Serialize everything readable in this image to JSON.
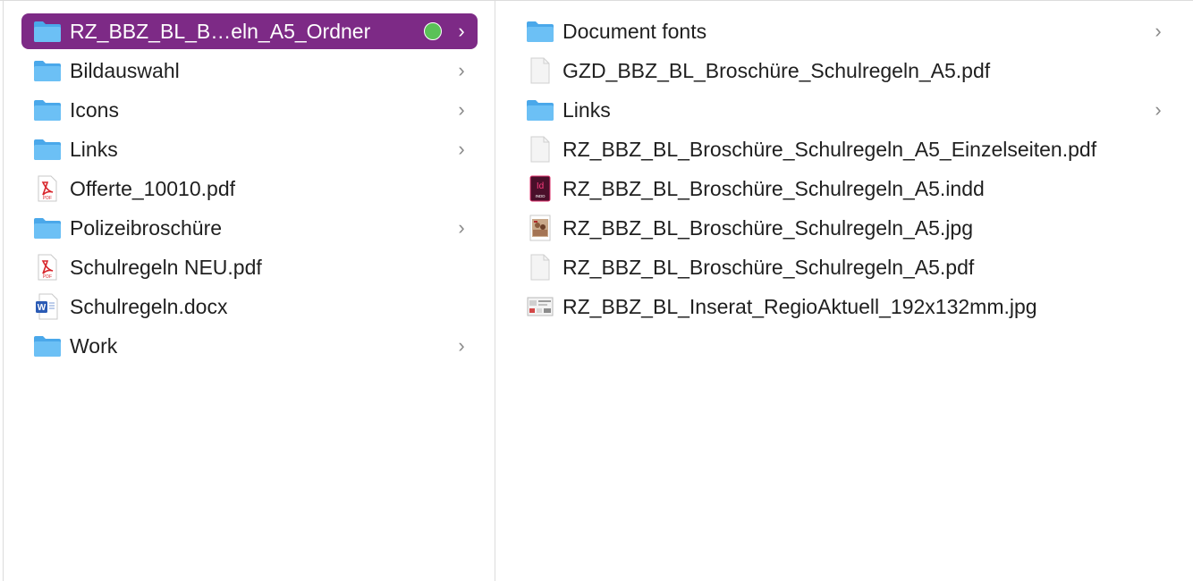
{
  "column1": {
    "items": [
      {
        "label": "RZ_BBZ_BL_B…eln_A5_Ordner",
        "icon": "folder-icon",
        "chevron": "›",
        "selected": true,
        "tag_color": "#5ac157"
      },
      {
        "label": "Bildauswahl",
        "icon": "folder-icon",
        "chevron": "›"
      },
      {
        "label": "Icons",
        "icon": "folder-icon",
        "chevron": "›"
      },
      {
        "label": "Links",
        "icon": "folder-icon",
        "chevron": "›"
      },
      {
        "label": "Offerte_10010.pdf",
        "icon": "pdf-file-icon",
        "chevron": ""
      },
      {
        "label": "Polizeibroschüre",
        "icon": "folder-icon",
        "chevron": "›"
      },
      {
        "label": "Schulregeln NEU.pdf",
        "icon": "pdf-file-icon",
        "chevron": ""
      },
      {
        "label": "Schulregeln.docx",
        "icon": "word-file-icon",
        "chevron": ""
      },
      {
        "label": "Work",
        "icon": "folder-icon",
        "chevron": "›"
      }
    ]
  },
  "column2": {
    "items": [
      {
        "label": "Document fonts",
        "icon": "folder-icon",
        "chevron": "›"
      },
      {
        "label": "GZD_BBZ_BL_Broschüre_Schulregeln_A5.pdf",
        "icon": "blank-file-icon",
        "chevron": ""
      },
      {
        "label": "Links",
        "icon": "folder-icon",
        "chevron": "›"
      },
      {
        "label": "RZ_BBZ_BL_Broschüre_Schulregeln_A5_Einzelseiten.pdf",
        "icon": "blank-file-icon",
        "chevron": ""
      },
      {
        "label": "RZ_BBZ_BL_Broschüre_Schulregeln_A5.indd",
        "icon": "indesign-file-icon",
        "chevron": ""
      },
      {
        "label": "RZ_BBZ_BL_Broschüre_Schulregeln_A5.jpg",
        "icon": "image-thumbnail-icon",
        "chevron": ""
      },
      {
        "label": "RZ_BBZ_BL_Broschüre_Schulregeln_A5.pdf",
        "icon": "blank-file-icon",
        "chevron": ""
      },
      {
        "label": "RZ_BBZ_BL_Inserat_RegioAktuell_192x132mm.jpg",
        "icon": "wide-image-thumbnail-icon",
        "chevron": ""
      }
    ]
  },
  "colors": {
    "selection": "#7d2a86",
    "folder": "#5bb4f0",
    "tag_green": "#5ac157",
    "pdf_red": "#d8262c",
    "word_blue": "#2b5bb5",
    "indesign": "#4a0f2a"
  }
}
